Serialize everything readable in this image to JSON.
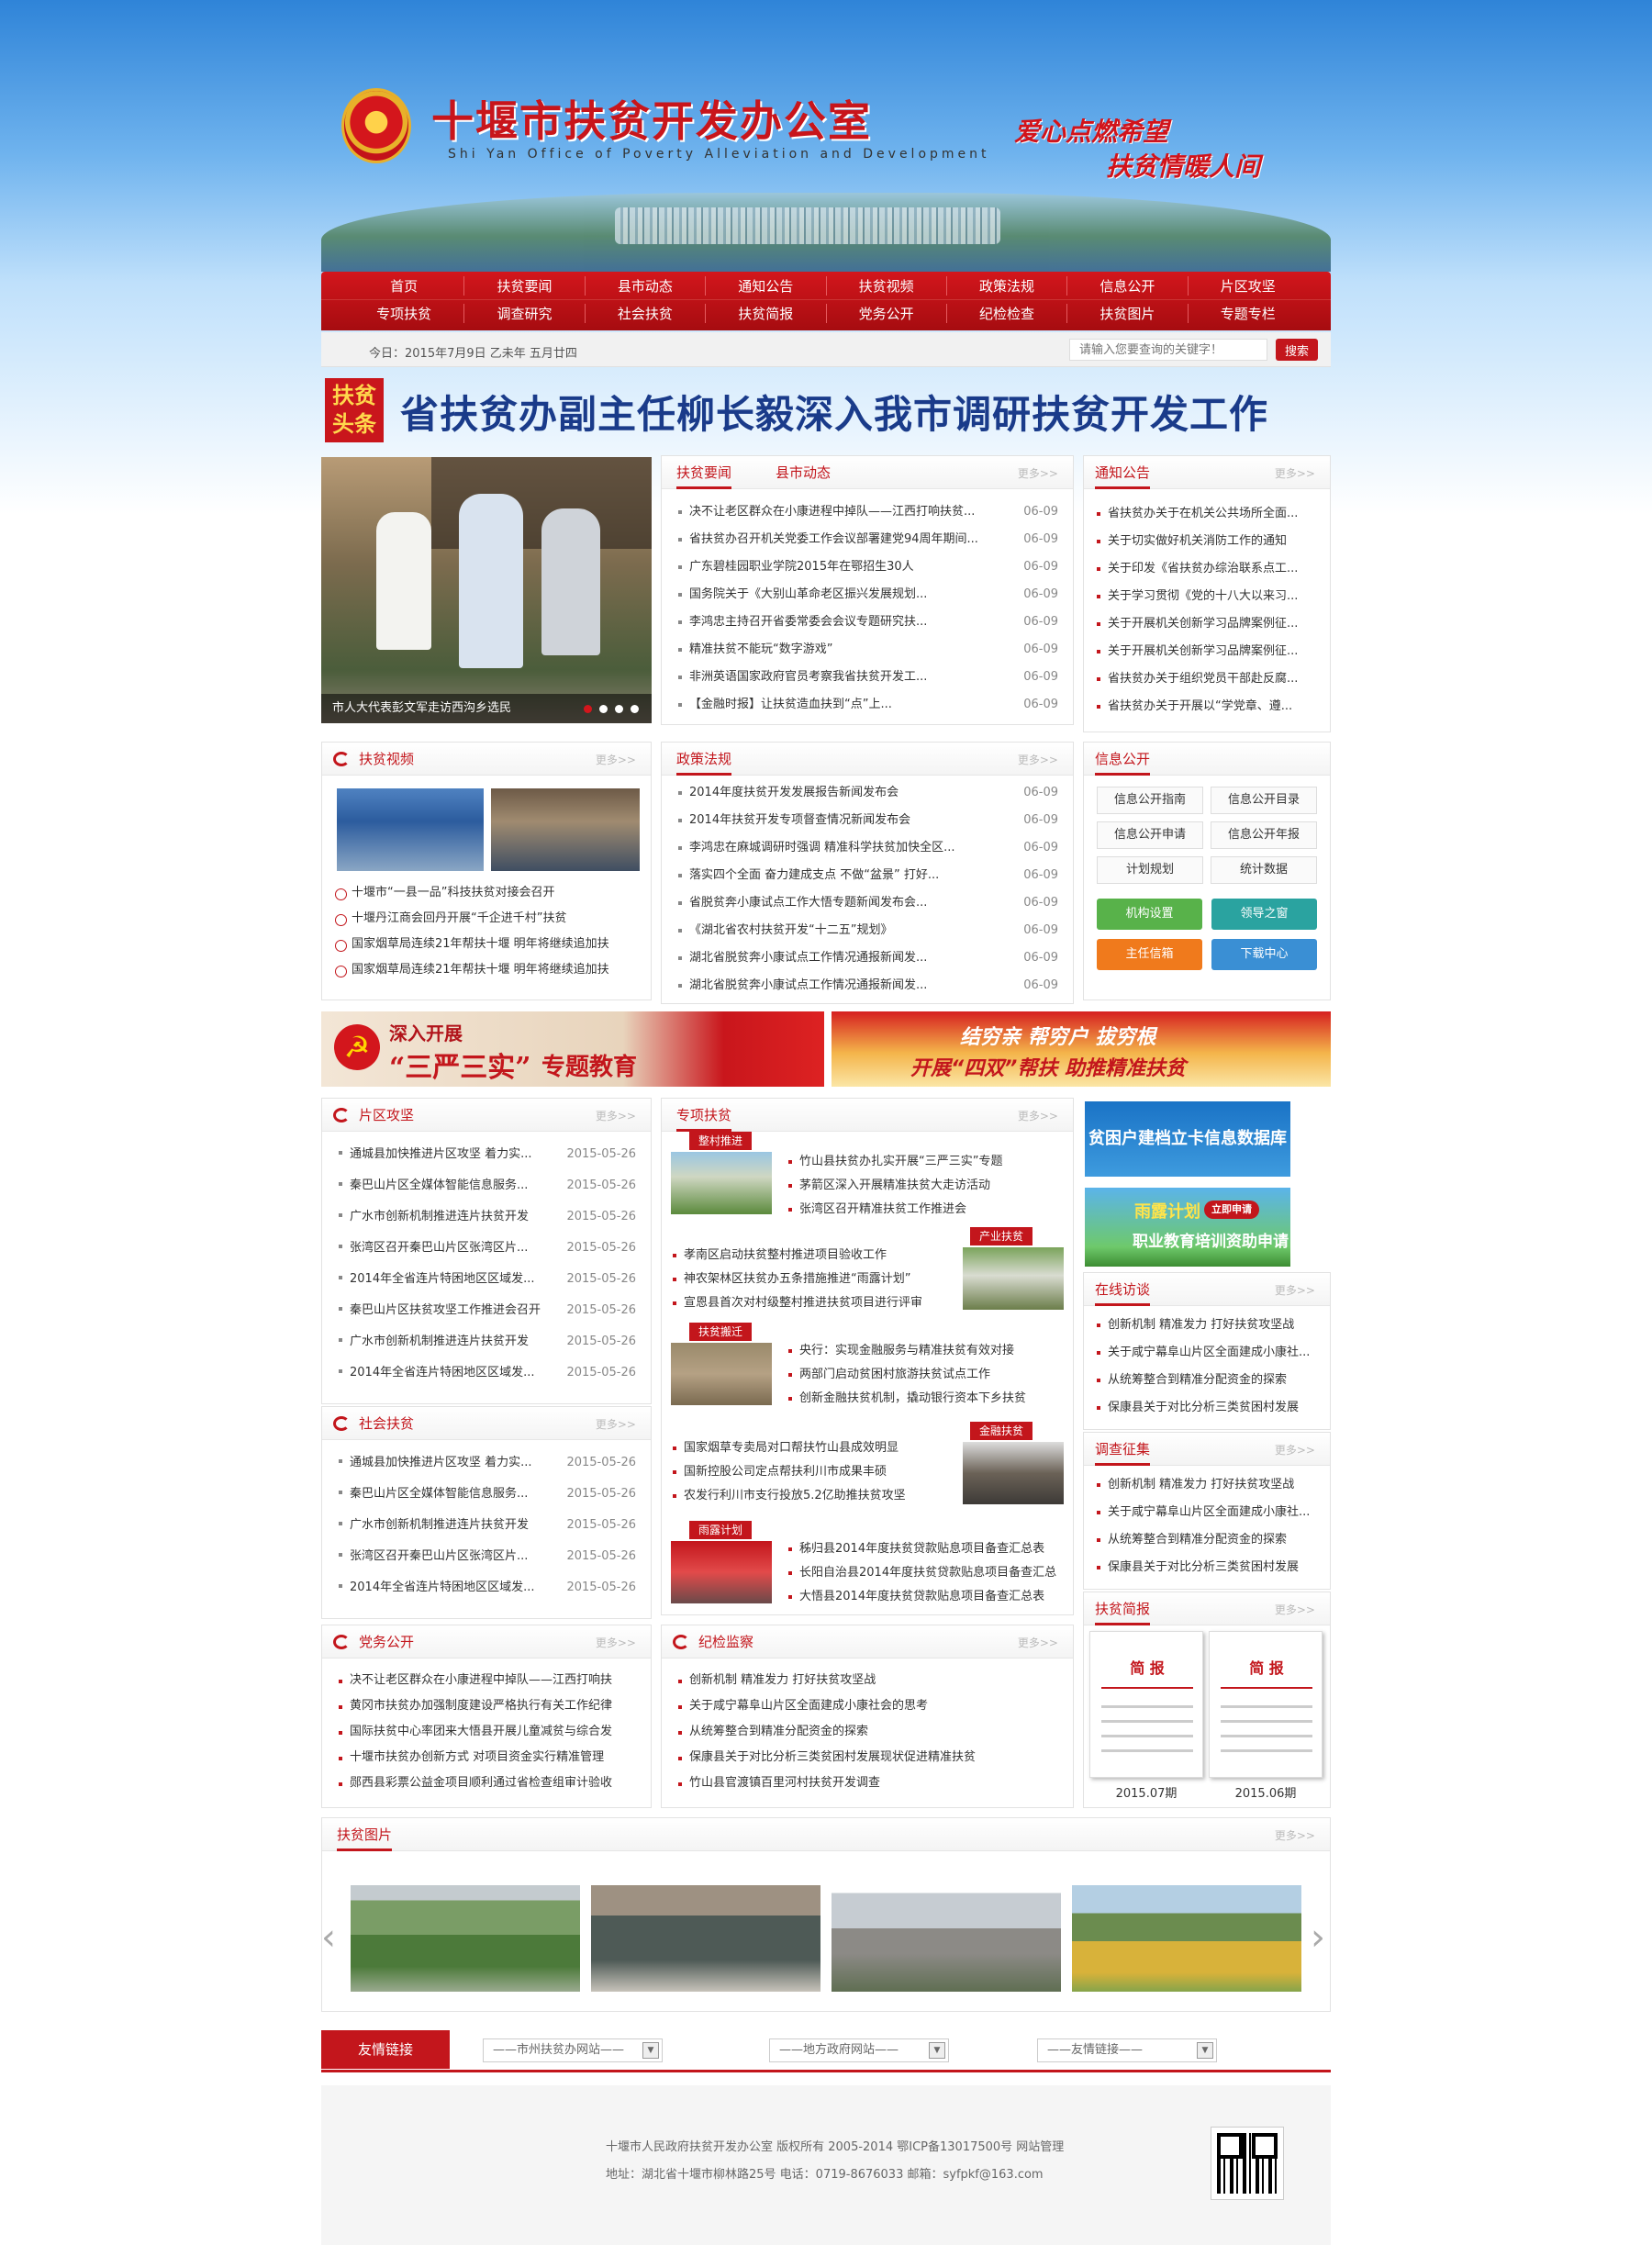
{
  "header": {
    "title": "十堰市扶贫开发办公室",
    "subtitle": "Shi Yan Office of Poverty Alleviation and Development",
    "slogan1": "爱心点燃希望",
    "slogan2": "扶贫情暖人间"
  },
  "nav": {
    "row1": [
      "首页",
      "扶贫要闻",
      "县市动态",
      "通知公告",
      "扶贫视频",
      "政策法规",
      "信息公开",
      "片区攻坚"
    ],
    "row2": [
      "专项扶贫",
      "调查研究",
      "社会扶贫",
      "扶贫简报",
      "党务公开",
      "纪检检查",
      "扶贫图片",
      "专题专栏"
    ]
  },
  "datebar": {
    "date": "今日：2015年7月9日 乙未年 五月廿四",
    "search_placeholder": "请输入您要查询的关键字！",
    "search_btn": "搜索"
  },
  "headline": {
    "badge1": "扶贫",
    "badge2": "头条",
    "text": "省扶贫办副主任柳长毅深入我市调研扶贫开发工作"
  },
  "slide": {
    "caption": "市人大代表彭文军走访西沟乡选民"
  },
  "more": "更多>>",
  "news": {
    "tab1": "扶贫要闻",
    "tab2": "县市动态",
    "items": [
      {
        "t": "决不让老区群众在小康进程中掉队——江西打响扶贫...",
        "d": "06-09"
      },
      {
        "t": "省扶贫办召开机关党委工作会议部署建党94周年期间...",
        "d": "06-09"
      },
      {
        "t": "广东碧桂园职业学院2015年在鄂招生30人",
        "d": "06-09"
      },
      {
        "t": "国务院关于《大别山革命老区振兴发展规划...",
        "d": "06-09"
      },
      {
        "t": "李鸿忠主持召开省委常委会会议专题研究扶...",
        "d": "06-09"
      },
      {
        "t": "精准扶贫不能玩“数字游戏”",
        "d": "06-09"
      },
      {
        "t": "非洲英语国家政府官员考察我省扶贫开发工...",
        "d": "06-09"
      },
      {
        "t": "【金融时报】让扶贫造血扶到“点”上...",
        "d": "06-09"
      }
    ]
  },
  "notice": {
    "title": "通知公告",
    "items": [
      "省扶贫办关于在机关公共场所全面...",
      "关于切实做好机关消防工作的通知",
      "关于印发《省扶贫办综治联系点工...",
      "关于学习贯彻《党的十八大以来习...",
      "关于开展机关创新学习品牌案例征...",
      "关于开展机关创新学习品牌案例征...",
      "省扶贫办关于组织党员干部赴反腐...",
      "省扶贫办关于开展以“学党章、遵..."
    ]
  },
  "video": {
    "title": "扶贫视频",
    "items": [
      "十堰市“一县一品”科技扶贫对接会召开",
      "十堰丹江商会回丹开展“千企进千村”扶贫",
      "国家烟草局连续21年帮扶十堰 明年将继续追加扶",
      "国家烟草局连续21年帮扶十堰 明年将继续追加扶"
    ]
  },
  "policy": {
    "title": "政策法规",
    "items": [
      {
        "t": "2014年度扶贫开发发展报告新闻发布会",
        "d": "06-09"
      },
      {
        "t": "2014年扶贫开发专项督查情况新闻发布会",
        "d": "06-09"
      },
      {
        "t": "李鸿忠在麻城调研时强调 精准科学扶贫加快全区...",
        "d": "06-09"
      },
      {
        "t": "落实四个全面 奋力建成支点 不做“盆景” 打好...",
        "d": "06-09"
      },
      {
        "t": "省脱贫奔小康试点工作大悟专题新闻发布会...",
        "d": "06-09"
      },
      {
        "t": "《湖北省农村扶贫开发“十二五”规划》",
        "d": "06-09"
      },
      {
        "t": "湖北省脱贫奔小康试点工作情况通报新闻发...",
        "d": "06-09"
      },
      {
        "t": "湖北省脱贫奔小康试点工作情况通报新闻发...",
        "d": "06-09"
      }
    ]
  },
  "info": {
    "title": "信息公开",
    "grid": [
      "信息公开指南",
      "信息公开目录",
      "信息公开申请",
      "信息公开年报",
      "计划规划",
      "统计数据"
    ],
    "btns": [
      "机构设置",
      "领导之窗",
      "主任信箱",
      "下载中心"
    ]
  },
  "banner1": {
    "a": "深入开展",
    "b": "“三严三实”",
    "c": "专题教育"
  },
  "banner2": {
    "a": "结穷亲 帮穷户 拔穷根",
    "b": "开展“四双”帮扶 助推精准扶贫"
  },
  "area": {
    "title": "片区攻坚",
    "items": [
      {
        "t": "通城县加快推进片区攻坚 着力实...",
        "d": "2015-05-26"
      },
      {
        "t": "秦巴山片区全媒体智能信息服务...",
        "d": "2015-05-26"
      },
      {
        "t": "广水市创新机制推进连片扶贫开发",
        "d": "2015-05-26"
      },
      {
        "t": "张湾区召开秦巴山片区张湾区片...",
        "d": "2015-05-26"
      },
      {
        "t": "2014年全省连片特困地区区域发...",
        "d": "2015-05-26"
      },
      {
        "t": "秦巴山片区扶贫攻坚工作推进会召开",
        "d": "2015-05-26"
      },
      {
        "t": "广水市创新机制推进连片扶贫开发",
        "d": "2015-05-26"
      },
      {
        "t": "2014年全省连片特困地区区域发...",
        "d": "2015-05-26"
      }
    ]
  },
  "social": {
    "title": "社会扶贫",
    "items": [
      {
        "t": "通城县加快推进片区攻坚 着力实...",
        "d": "2015-05-26"
      },
      {
        "t": "秦巴山片区全媒体智能信息服务...",
        "d": "2015-05-26"
      },
      {
        "t": "广水市创新机制推进连片扶贫开发",
        "d": "2015-05-26"
      },
      {
        "t": "张湾区召开秦巴山片区张湾区片...",
        "d": "2015-05-26"
      },
      {
        "t": "2014年全省连片特困地区区域发...",
        "d": "2015-05-26"
      }
    ]
  },
  "party": {
    "title": "党务公开",
    "items": [
      "决不让老区群众在小康进程中掉队——江西打响扶",
      "黄冈市扶贫办加强制度建设严格执行有关工作纪律",
      "国际扶贫中心率团来大悟县开展儿童减贫与综合发",
      "十堰市扶贫办创新方式 对项目资金实行精准管理",
      "郧西县彩票公益金项目顺利通过省检查组审计验收"
    ]
  },
  "special": {
    "title": "专项扶贫",
    "g1": {
      "tag": "整村推进",
      "items": [
        "竹山县扶贫办扎实开展“三严三实”专题",
        "茅箭区深入开展精准扶贫大走访活动",
        "张湾区召开精准扶贫工作推进会"
      ]
    },
    "g2": {
      "tag": "产业扶贫",
      "items": [
        "孝南区启动扶贫整村推进项目验收工作",
        "神农架林区扶贫办五条措施推进“雨露计划”",
        "宣恩县首次对村级整村推进扶贫项目进行评审"
      ]
    },
    "g3": {
      "tag": "扶贫搬迁",
      "items": [
        "央行：实现金融服务与精准扶贫有效对接",
        "两部门启动贫困村旅游扶贫试点工作",
        "创新金融扶贫机制，撬动银行资本下乡扶贫"
      ]
    },
    "g4": {
      "tag": "金融扶贫",
      "items": [
        "国家烟草专卖局对口帮扶竹山县成效明显",
        "国新控股公司定点帮扶利川市成果丰硕",
        "农发行利川市支行投放5.2亿助推扶贫攻坚"
      ]
    },
    "g5": {
      "tag": "雨露计划",
      "items": [
        "秭归县2014年度扶贫贷款贴息项目备查汇总表",
        "长阳自治县2014年度扶贫贷款贴息项目备查汇总",
        "大悟县2014年度扶贫贷款贴息项目备查汇总表"
      ]
    }
  },
  "discipline": {
    "title": "纪检监察",
    "items": [
      "创新机制 精准发力 打好扶贫攻坚战",
      "关于咸宁幕阜山片区全面建成小康社会的思考",
      "从统筹整合到精准分配资金的探索",
      "保康县关于对比分析三类贫困村发展现状促进精准扶贫",
      "竹山县官渡镇百里河村扶贫开发调查"
    ]
  },
  "rb1": "贫困户建档立卡信息数据库",
  "rb2": {
    "a": "雨露计划",
    "b": "职业教育培训资助申请",
    "btn": "立即申请"
  },
  "visit": {
    "title": "在线访谈",
    "items": [
      "创新机制 精准发力 打好扶贫攻坚战",
      "关于咸宁幕阜山片区全面建成小康社...",
      "从统筹整合到精准分配资金的探索",
      "保康县关于对比分析三类贫困村发展"
    ]
  },
  "survey": {
    "title": "调查征集",
    "items": [
      "创新机制 精准发力 打好扶贫攻坚战",
      "关于咸宁幕阜山片区全面建成小康社...",
      "从统筹整合到精准分配资金的探索",
      "保康县关于对比分析三类贫困村发展"
    ]
  },
  "brief": {
    "title": "扶贫简报",
    "cover": "简 报",
    "cap1": "2015.07期",
    "cap2": "2015.06期"
  },
  "photos": {
    "title": "扶贫图片"
  },
  "links": {
    "label": "友情链接",
    "s1": "——市州扶贫办网站——",
    "s2": "——地方政府网站——",
    "s3": "——友情链接——"
  },
  "footer": {
    "line1": "十堰市人民政府扶贫开发办公室 版权所有  2005-2014 鄂ICP备13017500号 网站管理",
    "line2": "地址：湖北省十堰市柳林路25号      电话：0719-8676033      邮箱：syfpkf@163.com"
  },
  "colors": {
    "primary": "#c3161c",
    "blue": "#1a73c6"
  }
}
